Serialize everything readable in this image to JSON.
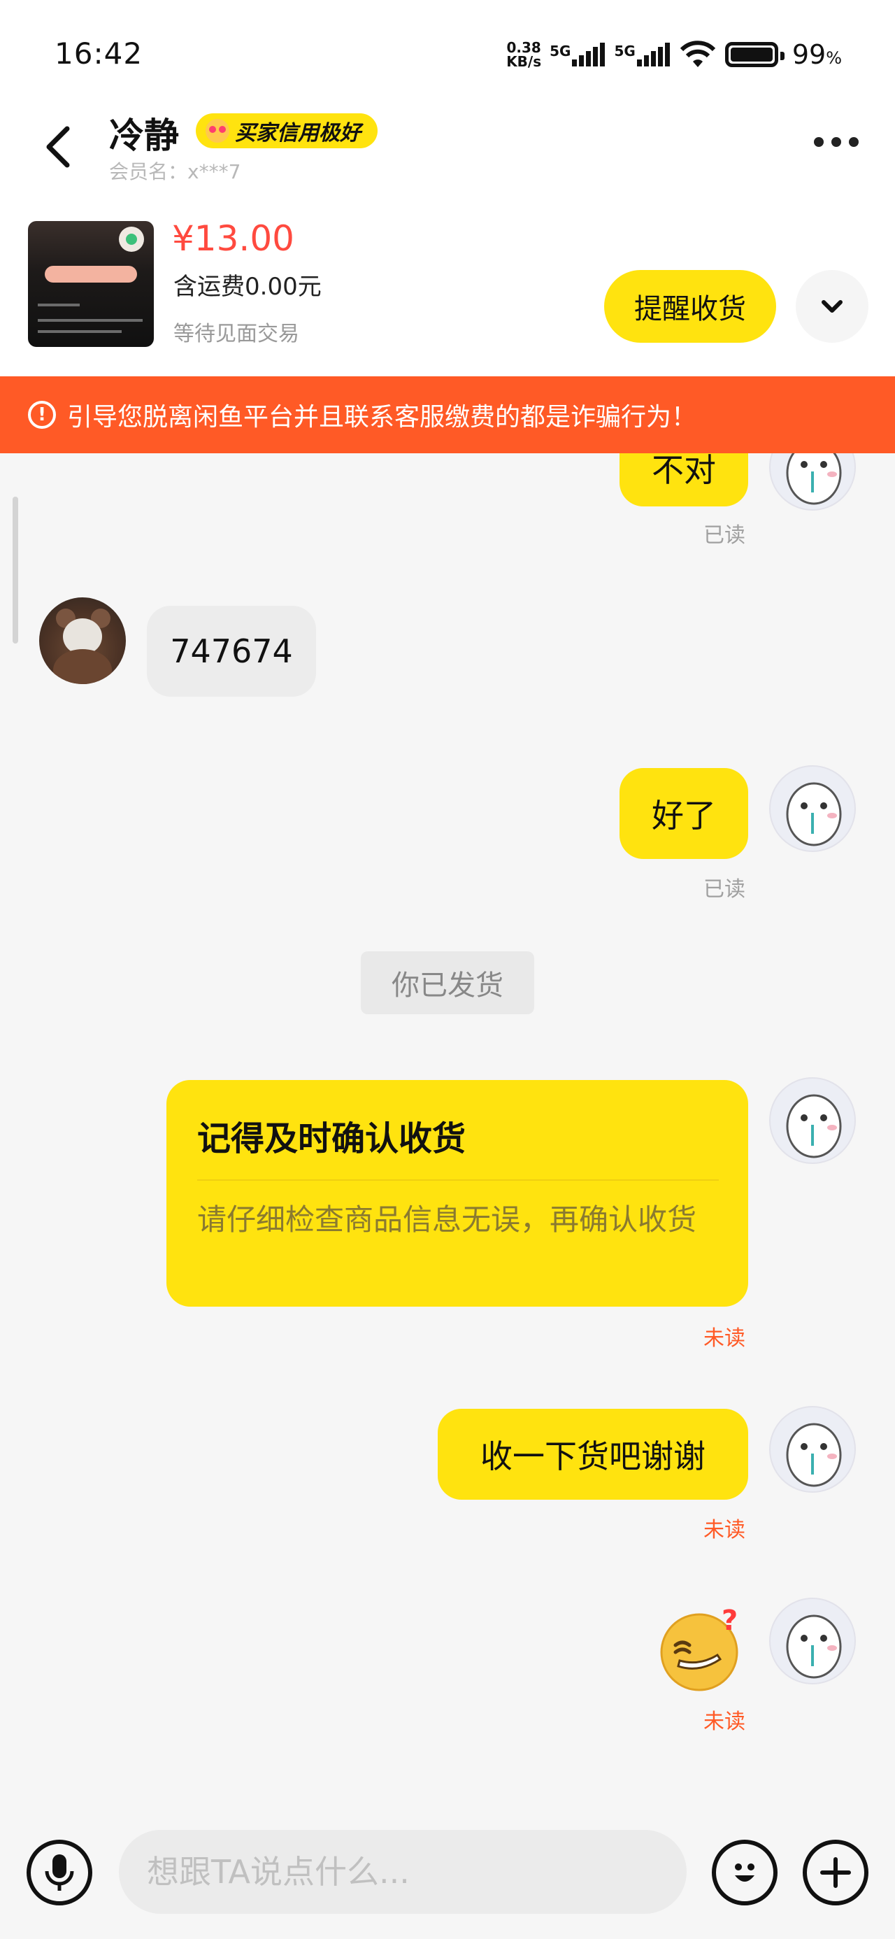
{
  "status_bar": {
    "time": "16:42",
    "net_speed_value": "0.38",
    "net_speed_unit": "KB/s",
    "sim1": "5G",
    "sim2": "5G",
    "battery_level": 0.99,
    "battery_text": "99",
    "battery_unit": "%"
  },
  "header": {
    "nickname": "冷静",
    "credit_badge": "买家信用极好",
    "member_label": "会员名：x***7",
    "icons": {
      "back": "back-arrow-icon",
      "more": "more-dots-icon",
      "expand": "chevron-down-icon"
    }
  },
  "product": {
    "price": "¥13.00",
    "shipping": "含运费0.00元",
    "trade_status": "等待见面交易",
    "remind_button": "提醒收货"
  },
  "warning": {
    "text": "引导您脱离闲鱼平台并且联系客服缴费的都是诈骗行为！",
    "icon": "warning-circle-icon"
  },
  "messages": [
    {
      "from": "me",
      "text": "不对",
      "status": "已读"
    },
    {
      "from": "other",
      "text": "747674"
    },
    {
      "from": "me",
      "text": "好了",
      "status": "已读"
    },
    {
      "from": "system",
      "text": "你已发货"
    },
    {
      "from": "me",
      "type": "card",
      "title": "记得及时确认收货",
      "body": "请仔细检查商品信息无误，再确认收货",
      "status": "未读"
    },
    {
      "from": "me",
      "text": "收一下货吧谢谢",
      "status": "未读"
    },
    {
      "from": "me",
      "type": "emoji",
      "emoji": "confused-grin-emoji",
      "status": "未读"
    }
  ],
  "input": {
    "placeholder": "想跟TA说点什么...",
    "value": "",
    "icons": {
      "voice": "microphone-icon",
      "emoji": "emoji-icon",
      "plus": "plus-icon"
    }
  },
  "colors": {
    "accent_yellow": "#ffe30f",
    "price_red": "#ff4a3f",
    "warning_orange": "#ff5a26",
    "unread_orange": "#ff5a26"
  }
}
